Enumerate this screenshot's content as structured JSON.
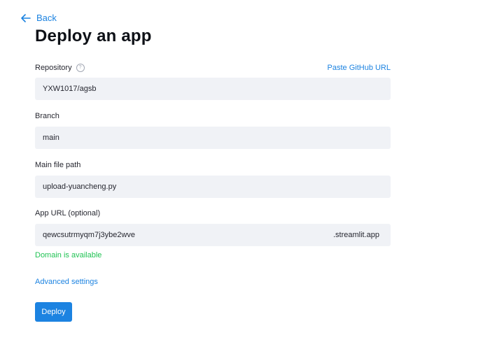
{
  "nav": {
    "back_label": "Back"
  },
  "page": {
    "title": "Deploy an app"
  },
  "repository": {
    "label": "Repository",
    "help_icon": "question-circle-icon",
    "paste_link": "Paste GitHub URL",
    "value": "YXW1017/agsb"
  },
  "branch": {
    "label": "Branch",
    "value": "main"
  },
  "main_file": {
    "label": "Main file path",
    "value": "upload-yuancheng.py"
  },
  "app_url": {
    "label": "App URL (optional)",
    "value": "qewcsutrmyqm7j3ybe2wve",
    "suffix": ".streamlit.app",
    "status": "Domain is available"
  },
  "advanced": {
    "label": "Advanced settings"
  },
  "deploy": {
    "label": "Deploy"
  },
  "colors": {
    "accent": "#1c83e1",
    "success": "#21c354",
    "field_bg": "#f0f2f6"
  }
}
